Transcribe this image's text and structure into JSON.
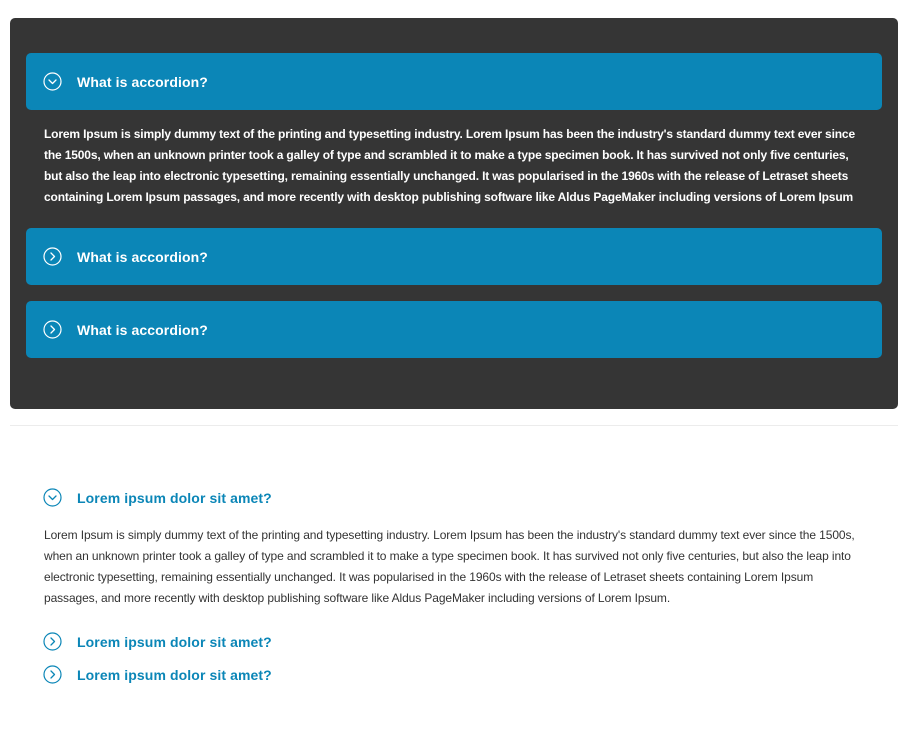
{
  "dark_accordion": {
    "items": [
      {
        "title": "What is accordion?",
        "expanded": true,
        "icon": "chevron-down-circle-icon"
      },
      {
        "title": "What is accordion?",
        "expanded": false,
        "icon": "chevron-right-circle-icon"
      },
      {
        "title": "What is accordion?",
        "expanded": false,
        "icon": "chevron-right-circle-icon"
      }
    ],
    "body": "Lorem Ipsum is simply dummy text of the printing and typesetting industry. Lorem Ipsum has been the industry's standard dummy text ever since the 1500s, when an unknown printer took a galley of type and scrambled it to make a type specimen book. It has survived not only five centuries, but also the leap into electronic typesetting, remaining essentially unchanged. It was popularised in the 1960s with the release of Letraset sheets containing Lorem Ipsum passages, and more recently with desktop publishing software like Aldus PageMaker including versions of Lorem Ipsum"
  },
  "light_accordion": {
    "items": [
      {
        "title": "Lorem ipsum dolor sit amet?",
        "expanded": true,
        "icon": "chevron-down-circle-icon"
      },
      {
        "title": "Lorem ipsum dolor sit amet?",
        "expanded": false,
        "icon": "chevron-right-circle-icon"
      },
      {
        "title": "Lorem ipsum dolor sit amet?",
        "expanded": false,
        "icon": "chevron-right-circle-icon"
      }
    ],
    "body": "Lorem Ipsum is simply dummy text of the printing and typesetting industry. Lorem Ipsum has been the industry's standard dummy text ever since the 1500s, when an unknown printer took a galley of type and scrambled it to make a type specimen book. It has survived not only five centuries, but also the leap into electronic typesetting, remaining essentially unchanged. It was popularised in the 1960s with the release of Letraset sheets containing Lorem Ipsum passages, and more recently with desktop publishing software like Aldus PageMaker including versions of Lorem Ipsum."
  },
  "colors": {
    "accent": "#0b86b7",
    "dark_panel": "#353535",
    "text_light": "#ffffff",
    "text_dark": "#333333"
  }
}
